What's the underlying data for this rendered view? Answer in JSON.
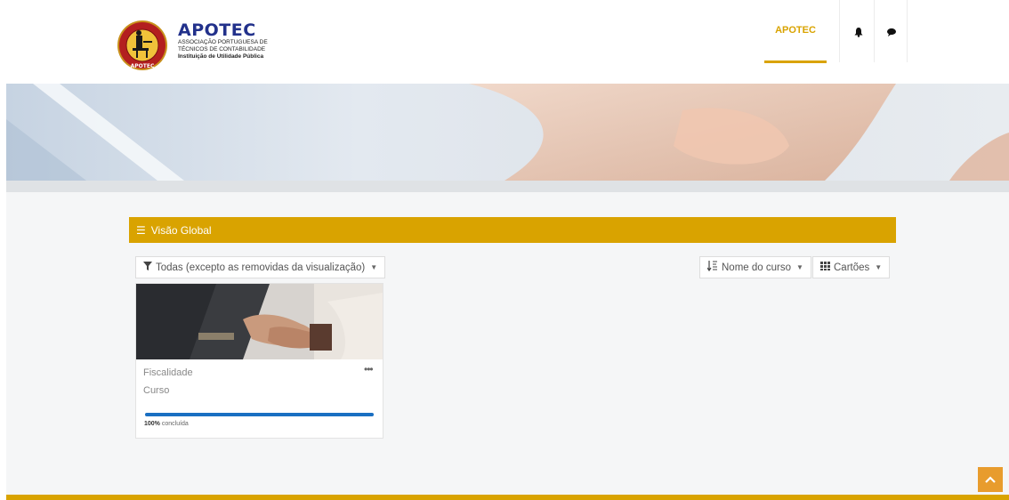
{
  "header": {
    "logo_title": "APOTEC",
    "logo_line1": "ASSOCIAÇÃO PORTUGUESA DE",
    "logo_line2": "TÉCNICOS DE CONTABILIDADE",
    "logo_line3": "Instituição de Utilidade Pública",
    "seal_text": "APOTEC",
    "nav_active": "APOTEC",
    "icons": [
      "bell-icon",
      "chat-icon"
    ],
    "accent_color": "#d9a300"
  },
  "overview": {
    "title": "Visão Global",
    "filter_label": "Todas (excepto as removidas da visualização)",
    "sort_label": "Nome do curso",
    "view_label": "Cartões"
  },
  "courses": [
    {
      "category": "Fiscalidade",
      "title": "Curso",
      "progress_percent": 100,
      "progress_value": "100%",
      "progress_text": "concluída"
    }
  ]
}
